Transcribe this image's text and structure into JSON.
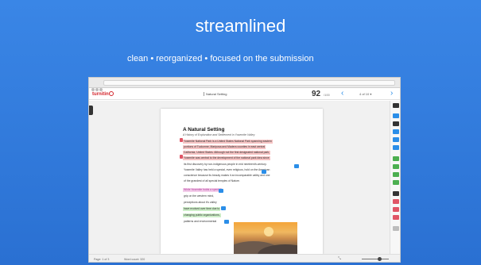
{
  "slide": {
    "title": "streamlined",
    "subtitle": "clean • reorganized • focused on the submission"
  },
  "appbar": {
    "logo": "turnitin",
    "doc_title": "Natural Setting",
    "score": "92",
    "score_max": "/100",
    "prev_icon": "‹",
    "page_indicator": "4 of 10 ▾",
    "next_icon": "›"
  },
  "paper": {
    "title": "A Natural Setting",
    "subtitle": "A History of Exploration and Settlement in Yosemite Valley",
    "lines": [
      "Yosemite National Park is a United States National Park spanning eastern",
      "portions of Tuolumne, Mariposa and Madera counties in east central",
      "California, United States. Although not the first designated national park,",
      "Yosemite was central to the development of the national park idea since",
      "its first discovery by non-indigenous people in mid nineteenth-century.",
      "Yosemite Valley has held a special, even religious, hold on the American",
      "conscience because its beauty makes it an incomparable valley and one",
      "of the grandest of all special temples of Nature.",
      "While Yosemite holds a special",
      "grip on the western mind,",
      "perceptions about it's valley",
      "have evolved over time due to",
      "changing public organizations,",
      "patterns and environmental"
    ]
  },
  "footer": {
    "page": "Page: 1 of 3",
    "words": "Word count: 320",
    "zoom_icon": "⤡"
  },
  "colors": {
    "slide_bg": "#2e78d8",
    "accent_blue": "#2b8ee8",
    "highlight_red": "#f6c4c4",
    "highlight_pink": "#f3cdea",
    "highlight_green": "#cdeec8",
    "logo_red": "#d2232a"
  },
  "rail_icons": [
    "layers-icon",
    "comment-icon",
    "quickmark-icon",
    "rubric-icon",
    "grading-icon",
    "info-icon",
    "green-tool-icon",
    "user-icon",
    "green-list-icon",
    "download-icon",
    "red-flag-icon",
    "red-report-icon",
    "filter-icon",
    "disable-icon",
    "settings-icon"
  ]
}
